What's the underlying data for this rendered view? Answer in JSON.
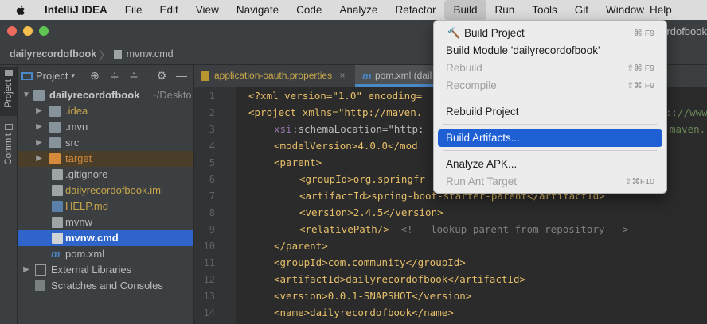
{
  "menubar": {
    "app": "IntelliJ IDEA",
    "items": [
      "File",
      "Edit",
      "View",
      "Navigate",
      "Code",
      "Analyze",
      "Refactor",
      "Build",
      "Run",
      "Tools",
      "Git",
      "Window",
      "Help"
    ],
    "active": "Build"
  },
  "window": {
    "title_partial": "cordofbook"
  },
  "breadcrumb": {
    "project": "dailyrecordofbook",
    "file": "mvnw.cmd"
  },
  "toolwindows": {
    "project": "Project",
    "commit": "Commit"
  },
  "project_panel": {
    "title": "Project",
    "root": {
      "name": "dailyrecordofbook",
      "path": "~/Deskto"
    },
    "items": [
      {
        "label": ".idea",
        "kind": "folder",
        "color": "#87939a"
      },
      {
        "label": ".mvn",
        "kind": "folder",
        "color": "#87939a"
      },
      {
        "label": "src",
        "kind": "folder",
        "color": "#87939a"
      },
      {
        "label": "target",
        "kind": "folder",
        "color": "#d58a3c"
      },
      {
        "label": ".gitignore",
        "kind": "file"
      },
      {
        "label": "dailyrecordofbook.iml",
        "kind": "file"
      },
      {
        "label": "HELP.md",
        "kind": "file"
      },
      {
        "label": "mvnw",
        "kind": "file"
      },
      {
        "label": "mvnw.cmd",
        "kind": "file"
      },
      {
        "label": "pom.xml",
        "kind": "file"
      }
    ],
    "external": "External Libraries",
    "scratches": "Scratches and Consoles"
  },
  "tabs": [
    {
      "label": "application-oauth.properties"
    },
    {
      "label": "pom.xml (dail"
    }
  ],
  "code": {
    "lines": [
      "1",
      "2",
      "3",
      "4",
      "5",
      "6",
      "7",
      "8",
      "9",
      "10",
      "11",
      "12",
      "13",
      "14"
    ],
    "l1a": "<?xml version=\"1.0\" encoding=",
    "l2a": "<project xmlns=\"http://maven.",
    "l2b": ":://www.",
    "l3a": "xsi",
    "l3b": ":schemaLocation=\"http:",
    "l3c": "maven.",
    "l4": "<modelVersion>4.0.0</mod",
    "l5": "<parent>",
    "l6": "<groupId>org.springfr",
    "l7": "<artifactId>spring-boot-starter-parent</artifactId>",
    "l8": "<version>2.4.5</version>",
    "l9a": "<relativePath/>",
    "l9b": " <!-- lookup parent from repository -->",
    "l10": "</parent>",
    "l11": "<groupId>com.community</groupId>",
    "l12": "<artifactId>dailyrecordofbook</artifactId>",
    "l13": "<version>0.0.1-SNAPSHOT</version>",
    "l14": "<name>dailyrecordofbook</name>"
  },
  "build_menu": {
    "items": [
      {
        "label": "Build Project",
        "shortcut": "⌘ F9",
        "enabled": true
      },
      {
        "label": "Build Module 'dailyrecordofbook'",
        "shortcut": "",
        "enabled": true
      },
      {
        "label": "Rebuild",
        "shortcut": "⇧⌘ F9",
        "enabled": false
      },
      {
        "label": "Recompile",
        "shortcut": "⇧⌘ F9",
        "enabled": false
      },
      {
        "label": "Rebuild Project",
        "shortcut": "",
        "enabled": true
      },
      {
        "label": "Build Artifacts...",
        "shortcut": "",
        "enabled": true,
        "highlighted": true
      },
      {
        "label": "Analyze APK...",
        "shortcut": "",
        "enabled": true
      },
      {
        "label": "Run Ant Target",
        "shortcut": "⇧⌘F10",
        "enabled": false
      }
    ]
  },
  "colors": {
    "highlight": "#1e5fd3",
    "selection": "#2f65ca",
    "editor_bg": "#2b2b2b",
    "panel_bg": "#3c3f41"
  }
}
